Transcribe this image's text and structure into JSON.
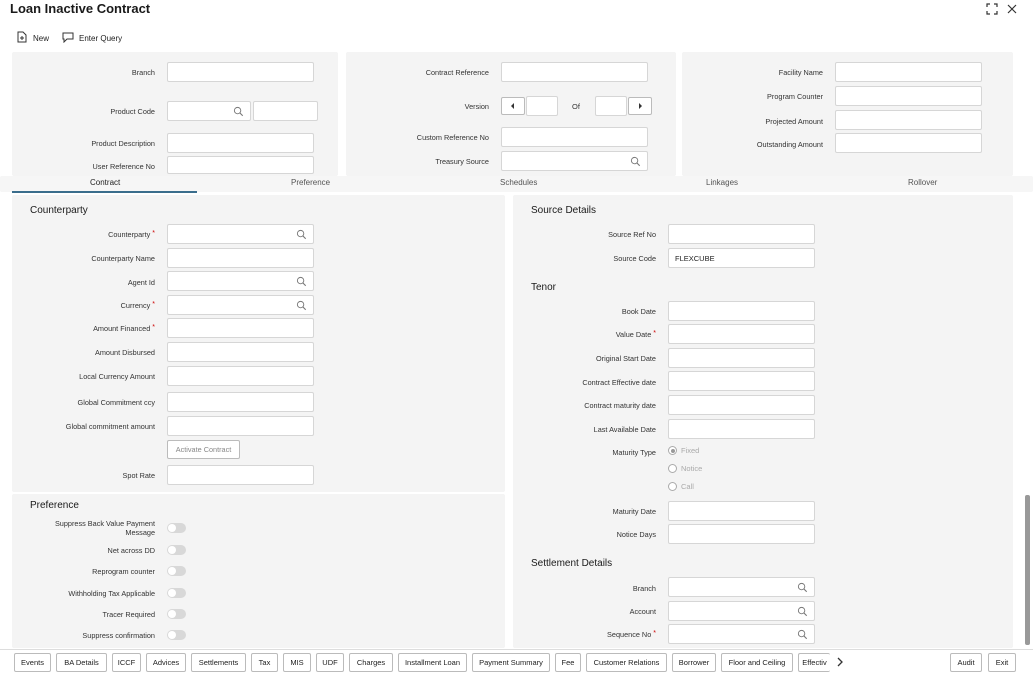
{
  "window": {
    "title": "Loan Inactive Contract",
    "expand_icon": "expand-icon",
    "close_icon": "close-icon"
  },
  "toolbar": {
    "new_label": "New",
    "enter_query_label": "Enter Query"
  },
  "header": {
    "branch_label": "Branch",
    "branch_value": "",
    "product_code_label": "Product Code",
    "product_code_value": "",
    "product_description_label": "Product Description",
    "user_reference_label": "User Reference No",
    "contract_reference_label": "Contract Reference",
    "version_label": "Version",
    "of_label": "Of",
    "custom_reference_label": "Custom Reference No",
    "treasury_source_label": "Treasury Source",
    "facility_name_label": "Facility Name",
    "program_counter_label": "Program Counter",
    "projected_amount_label": "Projected Amount",
    "outstanding_amount_label": "Outstanding Amount"
  },
  "tabs": [
    "Contract",
    "Preference",
    "Schedules",
    "Linkages",
    "Rollover"
  ],
  "counterparty": {
    "title": "Counterparty",
    "counterparty_label": "Counterparty",
    "counterparty_name_label": "Counterparty Name",
    "agent_id_label": "Agent Id",
    "currency_label": "Currency",
    "amount_financed_label": "Amount Financed",
    "amount_disbursed_label": "Amount Disbursed",
    "local_currency_amount_label": "Local Currency Amount",
    "global_commitment_ccy_label": "Global Commitment ccy",
    "global_commitment_amount_label": "Global commitment amount",
    "activate_contract_label": "Activate Contract",
    "spot_rate_label": "Spot Rate",
    "required_mark": "*"
  },
  "source": {
    "title": "Source Details",
    "source_ref_label": "Source Ref No",
    "source_code_label": "Source Code",
    "source_code_value": "FLEXCUBE"
  },
  "tenor": {
    "title": "Tenor",
    "book_date_label": "Book Date",
    "value_date_label": "Value Date",
    "original_start_date_label": "Original Start Date",
    "contract_effective_date_label": "Contract Effective date",
    "contract_maturity_date_label": "Contract maturity date",
    "last_available_date_label": "Last Available Date",
    "maturity_type_label": "Maturity Type",
    "maturity_options": [
      "Fixed",
      "Notice",
      "Call"
    ],
    "maturity_date_label": "Maturity Date",
    "notice_days_label": "Notice Days"
  },
  "preference": {
    "title": "Preference",
    "suppress_back_value_label": "Suppress Back Value Payment Message",
    "net_across_dd_label": "Net across DD",
    "reprogram_counter_label": "Reprogram counter",
    "withholding_tax_label": "Withholding Tax Applicable",
    "tracer_required_label": "Tracer Required",
    "suppress_confirmation_label": "Suppress confirmation"
  },
  "settlement": {
    "title": "Settlement Details",
    "branch_label": "Branch",
    "account_label": "Account",
    "sequence_no_label": "Sequence No"
  },
  "bottom_buttons": [
    "Events",
    "BA Details",
    "ICCF",
    "Advices",
    "Settlements",
    "Tax",
    "MIS",
    "UDF",
    "Charges",
    "Installment Loan",
    "Payment Summary",
    "Fee",
    "Customer Relations",
    "Borrower",
    "Floor and Ceiling",
    "Effectiv"
  ],
  "footer": {
    "audit_label": "Audit",
    "exit_label": "Exit"
  }
}
